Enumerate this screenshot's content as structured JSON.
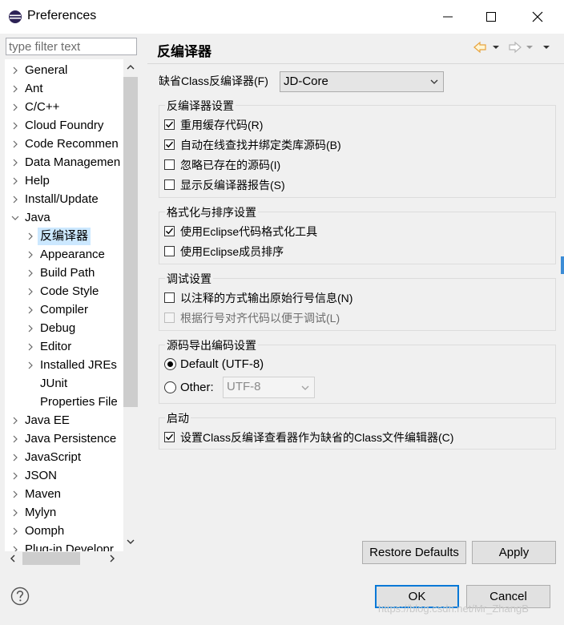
{
  "window": {
    "title": "Preferences",
    "minimize_icon": "minimize-icon",
    "maximize_icon": "maximize-icon",
    "close_icon": "close-icon"
  },
  "filter": {
    "placeholder": "type filter text",
    "value": ""
  },
  "tree": {
    "items": [
      {
        "label": "General",
        "level": 0,
        "expander": "collapsed"
      },
      {
        "label": "Ant",
        "level": 0,
        "expander": "collapsed"
      },
      {
        "label": "C/C++",
        "level": 0,
        "expander": "collapsed"
      },
      {
        "label": "Cloud Foundry",
        "level": 0,
        "expander": "collapsed"
      },
      {
        "label": "Code Recommen",
        "level": 0,
        "expander": "collapsed"
      },
      {
        "label": "Data Managemen",
        "level": 0,
        "expander": "collapsed"
      },
      {
        "label": "Help",
        "level": 0,
        "expander": "collapsed"
      },
      {
        "label": "Install/Update",
        "level": 0,
        "expander": "collapsed"
      },
      {
        "label": "Java",
        "level": 0,
        "expander": "expanded"
      },
      {
        "label": "反编译器",
        "level": 1,
        "expander": "collapsed",
        "selected": true
      },
      {
        "label": "Appearance",
        "level": 1,
        "expander": "collapsed"
      },
      {
        "label": "Build Path",
        "level": 1,
        "expander": "collapsed"
      },
      {
        "label": "Code Style",
        "level": 1,
        "expander": "collapsed"
      },
      {
        "label": "Compiler",
        "level": 1,
        "expander": "collapsed"
      },
      {
        "label": "Debug",
        "level": 1,
        "expander": "collapsed"
      },
      {
        "label": "Editor",
        "level": 1,
        "expander": "collapsed"
      },
      {
        "label": "Installed JREs",
        "level": 1,
        "expander": "collapsed"
      },
      {
        "label": "JUnit",
        "level": 1,
        "expander": "none"
      },
      {
        "label": "Properties File",
        "level": 1,
        "expander": "none"
      },
      {
        "label": "Java EE",
        "level": 0,
        "expander": "collapsed"
      },
      {
        "label": "Java Persistence",
        "level": 0,
        "expander": "collapsed"
      },
      {
        "label": "JavaScript",
        "level": 0,
        "expander": "collapsed"
      },
      {
        "label": "JSON",
        "level": 0,
        "expander": "collapsed"
      },
      {
        "label": "Maven",
        "level": 0,
        "expander": "collapsed"
      },
      {
        "label": "Mylyn",
        "level": 0,
        "expander": "collapsed"
      },
      {
        "label": "Oomph",
        "level": 0,
        "expander": "collapsed"
      },
      {
        "label": "Plug-in Developr",
        "level": 0,
        "expander": "collapsed"
      }
    ]
  },
  "page": {
    "title": "反编译器",
    "default_decompiler_label": "缺省Class反编译器(F)",
    "default_decompiler_value": "JD-Core",
    "groups": {
      "decompiler_settings": {
        "title": "反编译器设置",
        "options": [
          {
            "label": "重用缓存代码(R)",
            "checked": true
          },
          {
            "label": "自动在线查找并绑定类库源码(B)",
            "checked": true
          },
          {
            "label": "忽略已存在的源码(I)",
            "checked": false
          },
          {
            "label": "显示反编译器报告(S)",
            "checked": false
          }
        ]
      },
      "format_settings": {
        "title": "格式化与排序设置",
        "options": [
          {
            "label": "使用Eclipse代码格式化工具",
            "checked": true
          },
          {
            "label": "使用Eclipse成员排序",
            "checked": false
          }
        ]
      },
      "debug_settings": {
        "title": "调试设置",
        "options": [
          {
            "label": "以注释的方式输出原始行号信息(N)",
            "checked": false,
            "enabled": true
          },
          {
            "label": "根据行号对齐代码以便于调试(L)",
            "checked": false,
            "enabled": false
          }
        ]
      },
      "encoding_settings": {
        "title": "源码导出编码设置",
        "default_label": "Default (UTF-8)",
        "other_label": "Other:",
        "other_value": "UTF-8",
        "selected": "default"
      },
      "startup": {
        "title": "启动",
        "options": [
          {
            "label": "设置Class反编译查看器作为缺省的Class文件编辑器(C)",
            "checked": true
          }
        ]
      }
    },
    "restore_defaults_label": "Restore Defaults",
    "apply_label": "Apply"
  },
  "footer": {
    "help_icon": "help-icon",
    "ok_label": "OK",
    "cancel_label": "Cancel",
    "watermark": "https://blog.csdn.net/Mr_ZhangB"
  },
  "colors": {
    "selection_bg": "#cce8ff",
    "default_button_border": "#0078d7",
    "nav_back_arrow": "#e8a33d"
  }
}
